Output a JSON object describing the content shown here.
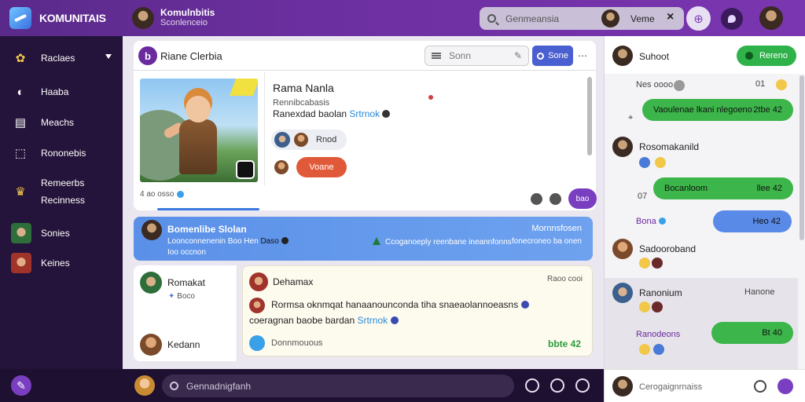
{
  "app": {
    "brand_name": "KOMUNITAIS",
    "accent_color": "#6c2fa0"
  },
  "topbar": {
    "user_name": "Komulnbitis",
    "user_sub": "Sconlenceio",
    "search_placeholder": "Genmeansia",
    "search_user_name": "Veme",
    "close_label": "×",
    "globe_icon": "globe-icon",
    "chat_icon": "chat-icon"
  },
  "sidebar": {
    "items": [
      {
        "label": "Raclaes",
        "icon": "star-icon"
      },
      {
        "label": "Haaba",
        "icon": "clock-icon"
      },
      {
        "label": "Meachs",
        "icon": "news-icon"
      },
      {
        "label": "Rononebis",
        "icon": "chart-icon"
      },
      {
        "label": "Remeerbs",
        "label2": "Recinness",
        "icon": "trophy-icon"
      },
      {
        "label": "Sonies",
        "icon": "avatar"
      },
      {
        "label": "Keines",
        "icon": "avatar"
      }
    ]
  },
  "post": {
    "header_icon": "b",
    "header_title": "Riane Clerbia",
    "search_placeholder": "Sonn",
    "save_label": "Sone",
    "more_label": "⋯",
    "player_name": "Rama Nanla",
    "player_sub": "Rennibcabasis",
    "player_tag": "Ranexdad baolan",
    "player_tag_link": "Srtrnok",
    "pill_label": "Rnod",
    "action_label": "Voane",
    "meta": "4 ao osso",
    "go_label": "bao"
  },
  "banner": {
    "title": "Bomenlibe Slolan",
    "line2": "Loonconnenenin Boo Hen",
    "line2b": "Daso",
    "line3": "Ioo occnon",
    "middle": "Ccoganoeply reenbane ineannfonns",
    "right1": "Mornnsfosen",
    "right2": "fonecroneo ba onen"
  },
  "comments_left": [
    {
      "name": "Romakat",
      "sub": "Boco"
    },
    {
      "name": "Kedann"
    }
  ],
  "comment": {
    "author": "Dehamax",
    "time": "Raoo cooi",
    "text1": "Rormsa oknmqat hanaanounconda tiha snaeaolannoeasns",
    "text2": "coeragnan baobe bardan",
    "text2_link": "Srtrnok",
    "footer": "Donnmouous",
    "count": "bbte 42"
  },
  "bottombar": {
    "input_placeholder": "Gennadnigfanh"
  },
  "chat": {
    "header_name": "Suhoot",
    "header_button": "Rereno",
    "msg_time1": "Nes oooo",
    "msg_count1": "01",
    "bubble1": "Vaoulenae lkani nlegoeno",
    "bubble1_time": "2tbe 42",
    "user2": "Rosomakanild",
    "bubble2": "Bocanloom",
    "bubble2_time": "llee 42",
    "msg_time2": "07",
    "label3": "Bona",
    "bubble3": "Heo 42",
    "user4": "Sadooroband",
    "user5": "Ranonium",
    "user5_time": "Hanone",
    "label6": "Ranodeons",
    "bubble6": "Bt 40",
    "input_placeholder": "Cerogaignrnaiss"
  }
}
